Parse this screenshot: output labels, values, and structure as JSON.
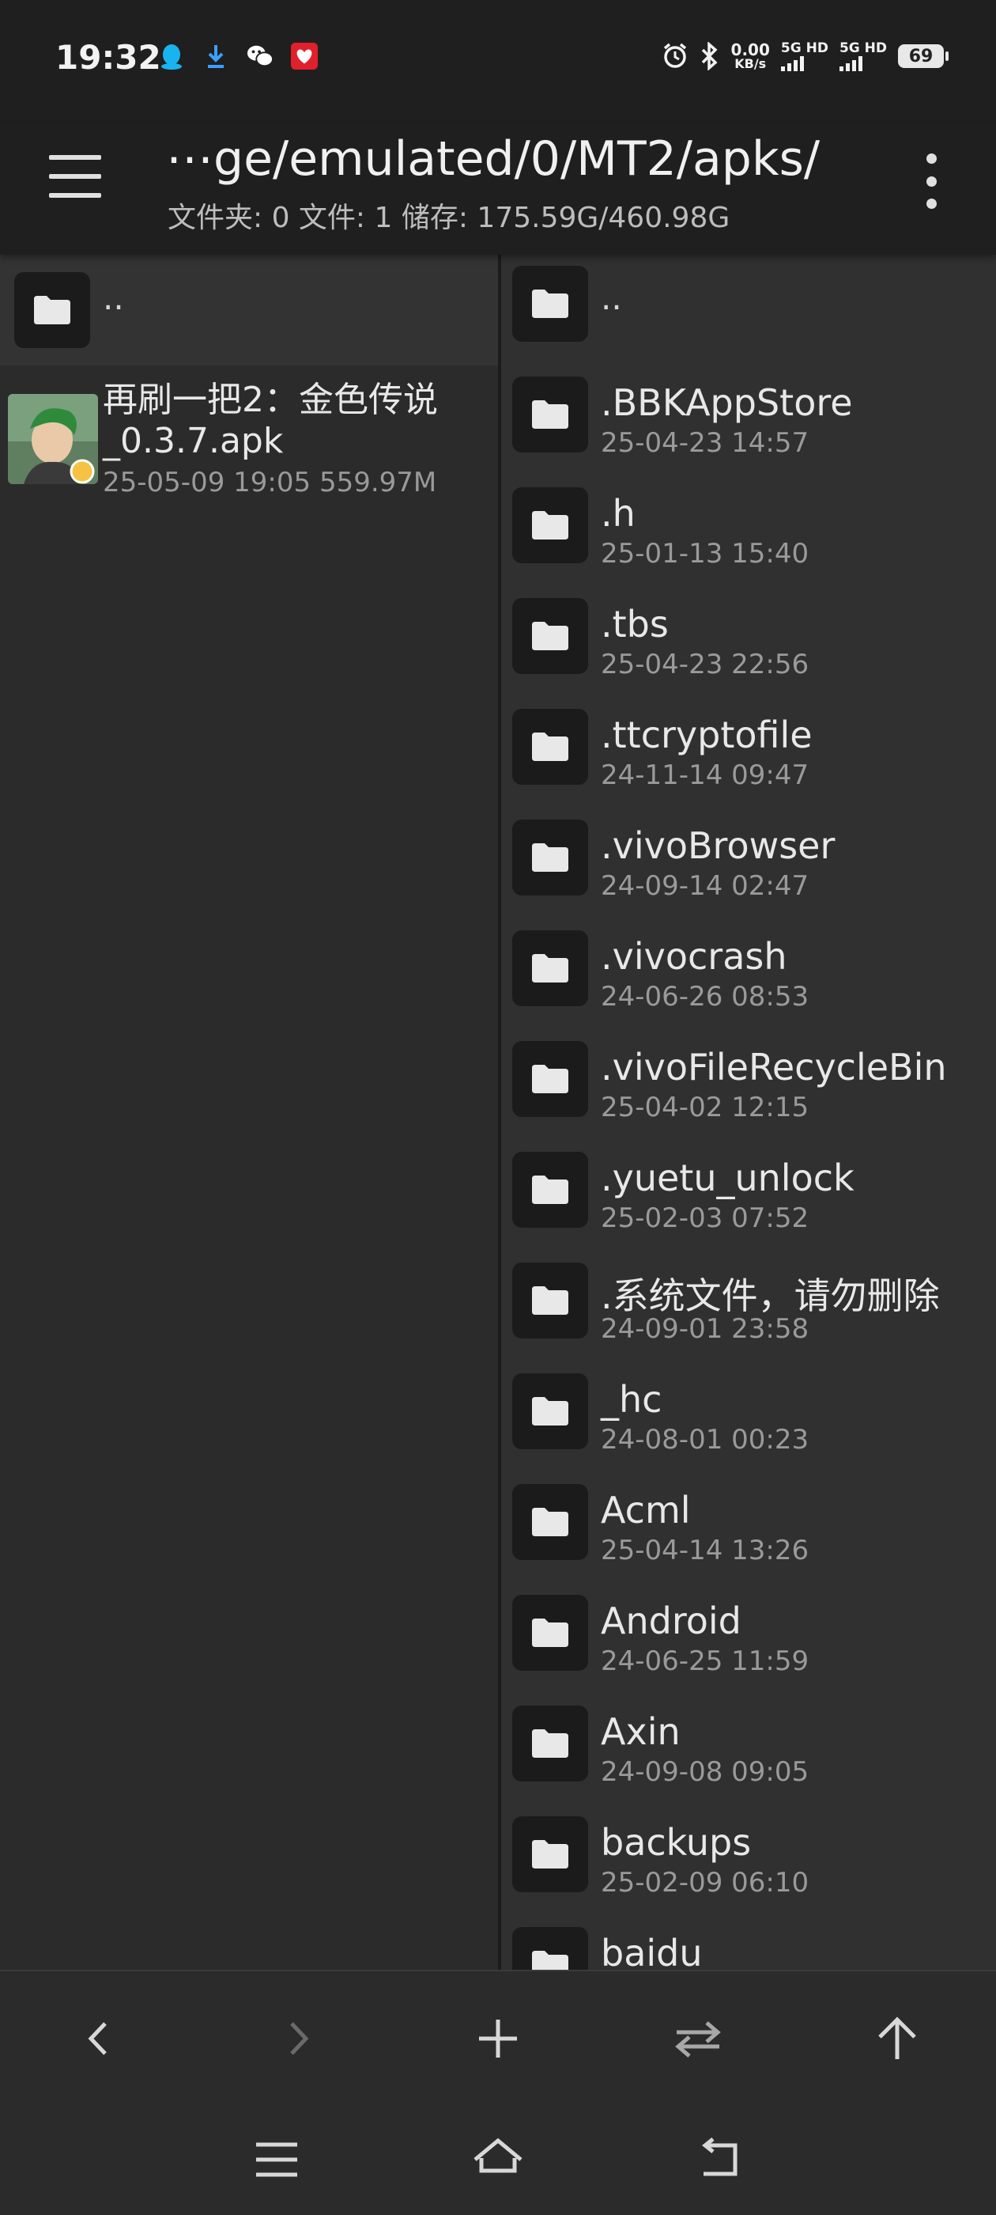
{
  "status_bar": {
    "time": "19:32",
    "left_icons": [
      "qq-icon",
      "download-icon",
      "wechat-icon",
      "app-notification-icon"
    ],
    "net_speed_value": "0.00",
    "net_speed_unit": "KB/s",
    "sim1_label": "5G HD",
    "sim2_label": "5G HD",
    "battery": "69"
  },
  "toolbar": {
    "path": "⋯ge/emulated/0/MT2/apks/",
    "stats": "文件夹: 0  文件: 1  储存: 175.59G/460.98G"
  },
  "left_pane": {
    "parent_label": "..",
    "files": [
      {
        "name": "再刷一把2：金色传说_0.3.7.apk",
        "date": "25-05-09 19:05",
        "size": "559.97M"
      }
    ]
  },
  "right_pane": {
    "parent_label": "..",
    "folders": [
      {
        "name": ".BBKAppStore",
        "date": "25-04-23 14:57"
      },
      {
        "name": ".h",
        "date": "25-01-13 15:40"
      },
      {
        "name": ".tbs",
        "date": "25-04-23 22:56"
      },
      {
        "name": ".ttcryptofile",
        "date": "24-11-14 09:47"
      },
      {
        "name": ".vivoBrowser",
        "date": "24-09-14 02:47"
      },
      {
        "name": ".vivocrash",
        "date": "24-06-26 08:53"
      },
      {
        "name": ".vivoFileRecycleBin",
        "date": "25-04-02 12:15"
      },
      {
        "name": ".yuetu_unlock",
        "date": "25-02-03 07:52"
      },
      {
        "name": ".系统文件，请勿删除",
        "date": "24-09-01 23:58"
      },
      {
        "name": "_hc",
        "date": "24-08-01 00:23"
      },
      {
        "name": "Acml",
        "date": "25-04-14 13:26"
      },
      {
        "name": "Android",
        "date": "24-06-25 11:59"
      },
      {
        "name": "Axin",
        "date": "24-09-08 09:05"
      },
      {
        "name": "backups",
        "date": "25-02-09 06:10"
      },
      {
        "name": "baidu",
        "date": ""
      }
    ]
  },
  "bottom_toolbar": [
    "back-icon",
    "forward-icon",
    "add-icon",
    "swap-icon",
    "up-icon"
  ],
  "nav_bar": [
    "menu-icon",
    "home-icon",
    "return-icon"
  ]
}
